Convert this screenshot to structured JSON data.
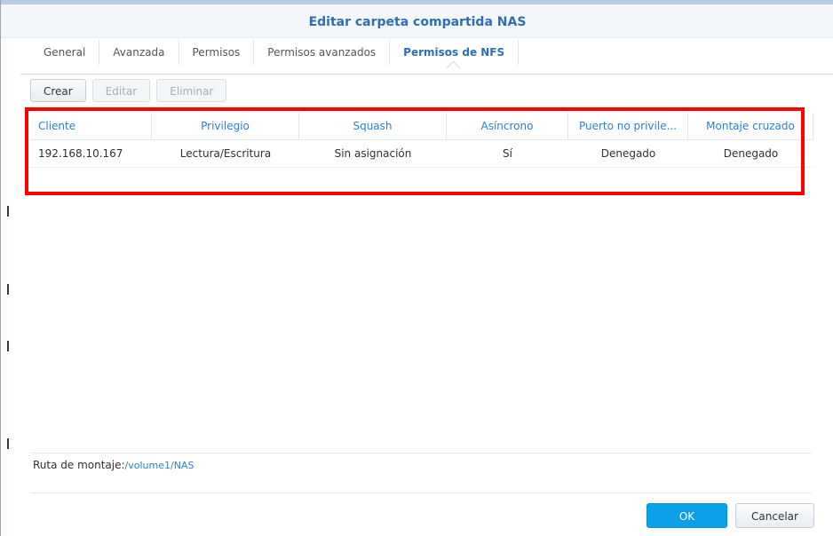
{
  "window": {
    "title": "Editar carpeta compartida NAS"
  },
  "tabs": [
    {
      "label": "General",
      "active": false
    },
    {
      "label": "Avanzada",
      "active": false
    },
    {
      "label": "Permisos",
      "active": false
    },
    {
      "label": "Permisos avanzados",
      "active": false
    },
    {
      "label": "Permisos de NFS",
      "active": true
    }
  ],
  "toolbar": {
    "create_label": "Crear",
    "edit_label": "Editar",
    "delete_label": "Eliminar"
  },
  "grid": {
    "columns": [
      "Cliente",
      "Privilegio",
      "Squash",
      "Asíncrono",
      "Puerto no privile...",
      "Montaje cruzado"
    ],
    "rows": [
      [
        "192.168.10.167",
        "Lectura/Escritura",
        "Sin asignación",
        "Sí",
        "Denegado",
        "Denegado"
      ]
    ]
  },
  "footer": {
    "mount_label": "Ruta de montaje:",
    "mount_value": "/volume1/NAS",
    "ok_label": "OK",
    "cancel_label": "Cancelar"
  },
  "colors": {
    "accent": "#2f80d1",
    "title": "#2f6db4",
    "ok_button": "#0aa0ea",
    "highlight": "#ff0000"
  }
}
